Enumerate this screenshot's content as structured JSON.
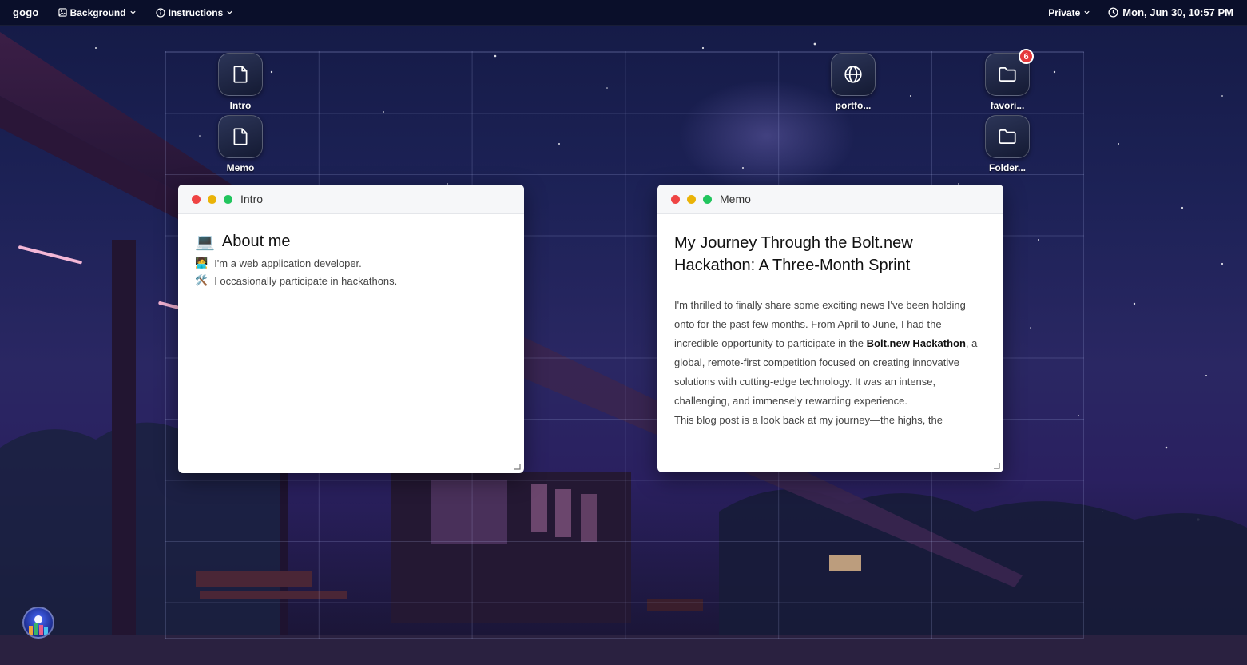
{
  "topbar": {
    "brand": "gogo",
    "menus": [
      {
        "label": "Background",
        "icon": "image-icon"
      },
      {
        "label": "Instructions",
        "icon": "info-icon"
      }
    ],
    "privacy_label": "Private",
    "clock": "Mon, Jun 30, 10:57 PM"
  },
  "desktop_icons": [
    {
      "label": "Intro",
      "icon": "file-icon"
    },
    {
      "label": "Memo",
      "icon": "file-icon"
    },
    {
      "label": "portfo...",
      "icon": "globe-icon"
    },
    {
      "label": "favori...",
      "icon": "folder-icon",
      "badge": "6"
    },
    {
      "label": "Folder...",
      "icon": "folder-icon"
    }
  ],
  "windows": {
    "intro": {
      "title": "Intro",
      "heading_emoji": "💻",
      "heading": "About me",
      "lines": [
        {
          "emoji": "🧑‍💻",
          "text": "I'm a web application developer."
        },
        {
          "emoji": "🛠️",
          "text": "I occasionally participate in hackathons."
        }
      ]
    },
    "memo": {
      "title": "Memo",
      "heading": "My Journey Through the Bolt.new Hackathon: A Three-Month Sprint",
      "para1_a": "I'm thrilled to finally share some exciting news I've been holding onto for the past few months. From April to June, I had the incredible opportunity to participate in the ",
      "para1_bold": "Bolt.new Hackathon",
      "para1_b": ", a global, remote-first competition focused on creating innovative solutions with cutting-edge technology. It was an intense, challenging, and immensely rewarding experience.",
      "para2": "This blog post is a look back at my journey—the highs, the"
    }
  },
  "colors": {
    "topbar_bg": "#0a0e28",
    "traffic_red": "#ef4444",
    "traffic_yellow": "#eab308",
    "traffic_green": "#22c55e",
    "badge_red": "#e5383b"
  }
}
